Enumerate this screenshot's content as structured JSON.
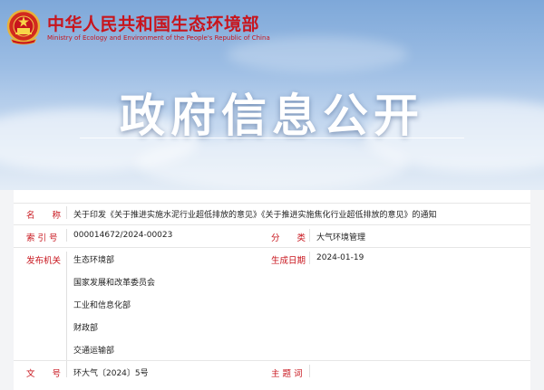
{
  "header": {
    "site_title_cn": "中华人民共和国生态环境部",
    "site_title_en": "Ministry of Ecology and Environment of the People's Republic of China",
    "banner_title": "政府信息公开",
    "emblem_icon": "national-emblem-icon"
  },
  "record": {
    "name": {
      "label": "名　　称",
      "value": "关于印发《关于推进实施水泥行业超低排放的意见》《关于推进实施焦化行业超低排放的意见》的通知"
    },
    "index_no": {
      "label": "索 引 号",
      "value": "000014672/2024-00023"
    },
    "category": {
      "label": "分　　类",
      "value": "大气环境管理"
    },
    "issuer": {
      "label": "发布机关",
      "values": [
        "生态环境部",
        "国家发展和改革委员会",
        "工业和信息化部",
        "财政部",
        "交通运输部"
      ]
    },
    "date": {
      "label": "生成日期",
      "value": "2024-01-19"
    },
    "doc_no": {
      "label": "文　　号",
      "value": "环大气〔2024〕5号"
    },
    "subject": {
      "label": "主 题 词",
      "value": ""
    }
  },
  "colors": {
    "accent_red": "#c8151d",
    "sky_blue": "#7ea8d9"
  }
}
